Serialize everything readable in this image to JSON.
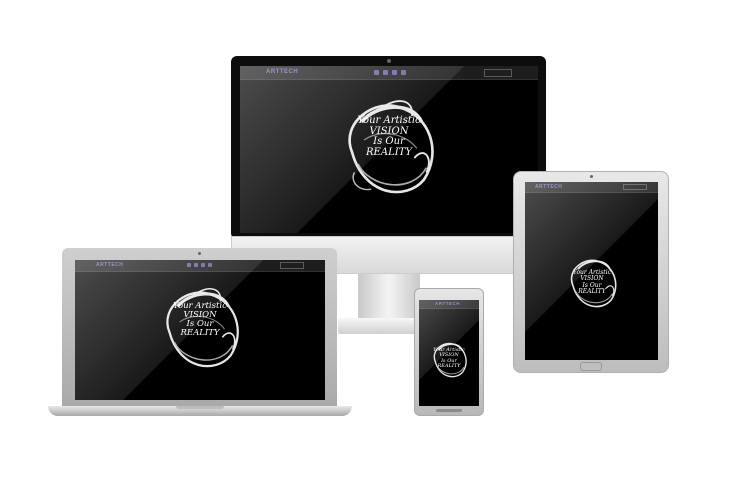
{
  "brand": "ARTTECH",
  "hero": {
    "line1": "Your Artistic",
    "line2": "VISION",
    "line3": "Is Our",
    "line4": "REALITY"
  }
}
